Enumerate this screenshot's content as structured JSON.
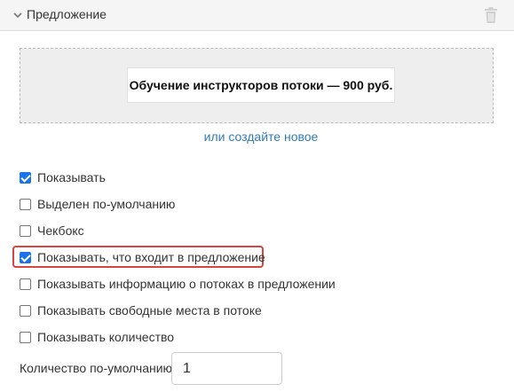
{
  "header": {
    "title": "Предложение"
  },
  "offer": {
    "item_title": "Обучение инструкторов потоки — 900 руб.",
    "create_link": "или создайте новое"
  },
  "options": [
    {
      "label": "Показывать",
      "checked": true
    },
    {
      "label": "Выделен по-умолчанию",
      "checked": false
    },
    {
      "label": "Чекбокс",
      "checked": false
    },
    {
      "label": "Показывать, что входит в предложение",
      "checked": true
    },
    {
      "label": "Показывать информацию о потоках в предложении",
      "checked": false
    },
    {
      "label": "Показывать свободные места в потоке",
      "checked": false
    },
    {
      "label": "Показывать количество",
      "checked": false
    }
  ],
  "quantity": {
    "label": "Количество по-умолчанию",
    "value": "1"
  }
}
